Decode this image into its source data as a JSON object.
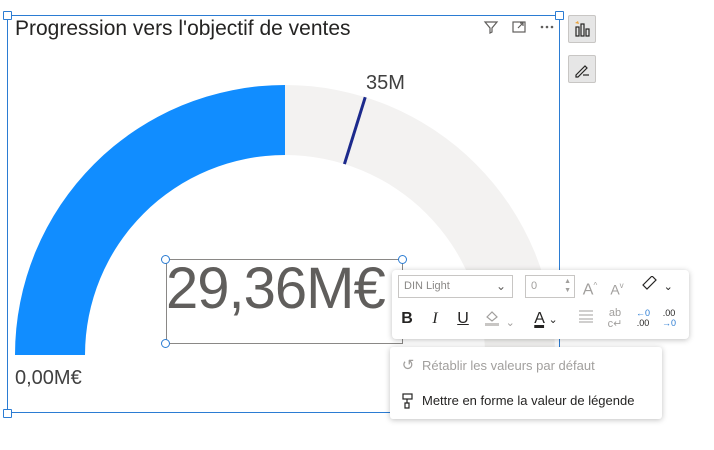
{
  "visual": {
    "title": "Progression vers l'objectif de ventes",
    "header_icons": [
      "filter-icon",
      "focus-mode-icon",
      "more-options-icon"
    ]
  },
  "side_panel": {
    "buttons": [
      "build-visual-icon",
      "format-visual-icon"
    ]
  },
  "gauge": {
    "value_label": "29,36M€",
    "min_label": "0,00M€",
    "target_label": "35M",
    "value": 29.36,
    "min": 0,
    "max": 58.72,
    "target": 35,
    "fill_color": "#118dff",
    "track_color": "#f3f2f1",
    "target_color": "#1c2a8c"
  },
  "format_toolbar": {
    "font_family": "DIN Light",
    "font_size": "0",
    "increase_font_label": "A",
    "decrease_font_label": "A",
    "bold_label": "B",
    "italic_label": "I",
    "underline_label": "U",
    "font_color_label": "A",
    "decimal_decrease_label": ".00",
    "decimal_increase_label": ".00"
  },
  "context_menu": {
    "items": [
      {
        "label": "Rétablir les valeurs par défaut",
        "icon": "reset-icon",
        "enabled": false
      },
      {
        "label": "Mettre en forme la valeur de légende",
        "icon": "format-painter-icon",
        "enabled": true
      }
    ]
  }
}
